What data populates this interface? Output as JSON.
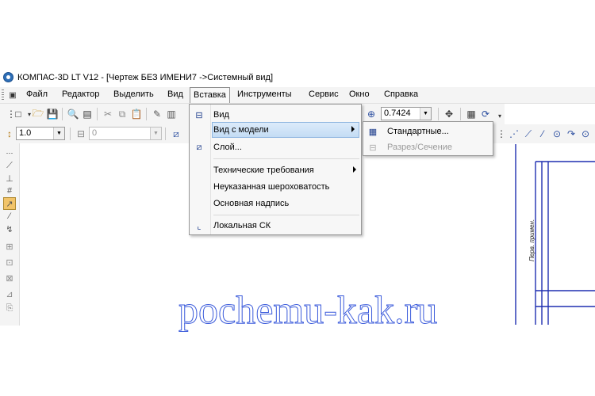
{
  "window": {
    "title": "КОМПАС-3D LT V12 - [Чертеж БЕЗ ИМЕНИ7 ->Системный вид]"
  },
  "menubar": {
    "items": [
      "Файл",
      "Редактор",
      "Выделить",
      "Вид",
      "Вставка",
      "Инструменты",
      "Сервис",
      "Окно",
      "Справка"
    ]
  },
  "toolbar": {
    "zoom_value": "0.7424",
    "line_scale": "1.0",
    "layer_value": "0"
  },
  "insert_menu": {
    "items": [
      {
        "label": "Вид",
        "icon": "view-icon"
      },
      {
        "label": "Вид с модели",
        "icon": "",
        "submenu": true
      },
      {
        "label": "Слой...",
        "icon": "layer-icon"
      },
      {
        "label": "Технические требования",
        "icon": "",
        "submenu": true
      },
      {
        "label": "Неуказанная шероховатость",
        "icon": ""
      },
      {
        "label": "Основная надпись",
        "icon": ""
      },
      {
        "label": "Локальная СК",
        "icon": "local-cs-icon"
      }
    ]
  },
  "model_view_submenu": {
    "items": [
      {
        "label": "Стандартные...",
        "icon": "standard-views-icon",
        "enabled": true
      },
      {
        "label": "Разрез/Сечение",
        "icon": "section-icon",
        "enabled": false
      }
    ]
  },
  "drawing": {
    "frame_text": "Перв. примен."
  },
  "watermark": "pochemu-kak.ru",
  "colors": {
    "accent": "#2e6fb7",
    "frame": "#1f2fb0",
    "watermark": "#3b5bdb",
    "highlight": "#c4dcf4"
  }
}
